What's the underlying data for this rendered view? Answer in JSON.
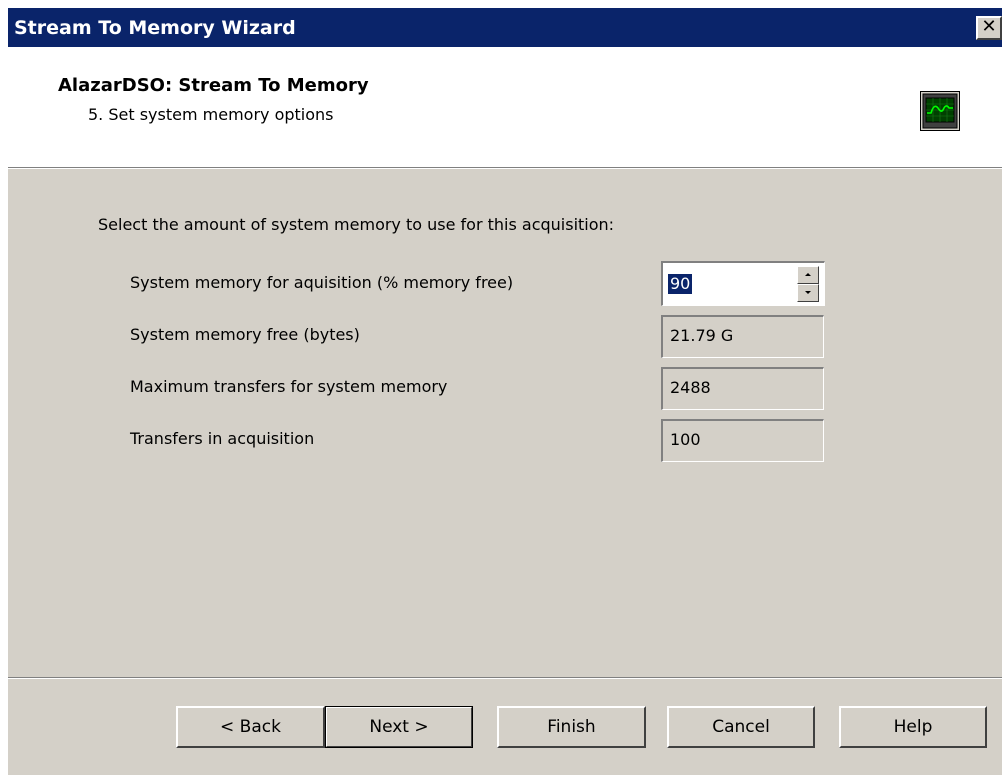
{
  "window": {
    "title": "Stream To Memory Wizard",
    "close_label": "✕"
  },
  "header": {
    "title": "AlazarDSO: Stream To Memory",
    "subtitle": "5. Set system memory options",
    "icon": "oscilloscope-icon"
  },
  "main": {
    "instruction": "Select the amount of system memory to use for this acquisition:",
    "rows": [
      {
        "label": "System memory for aquisition (% memory free)",
        "value": "90"
      },
      {
        "label": "System memory free (bytes)",
        "value": "21.79 G"
      },
      {
        "label": "Maximum transfers for system memory",
        "value": "2488"
      },
      {
        "label": "Transfers in acquisition",
        "value": "100"
      }
    ]
  },
  "buttons": {
    "back": "< Back",
    "next": "Next >",
    "finish": "Finish",
    "cancel": "Cancel",
    "help": "Help"
  },
  "colors": {
    "titlebar": "#0a246a",
    "dialog_face": "#d4d0c8",
    "screen_green": "#00ff00"
  }
}
